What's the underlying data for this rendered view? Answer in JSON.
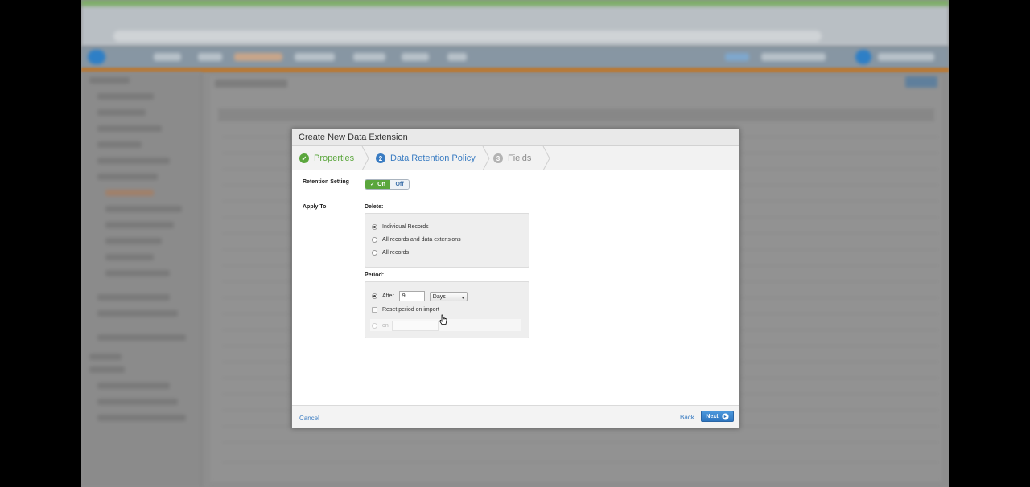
{
  "modal": {
    "title": "Create New Data Extension"
  },
  "steps": [
    {
      "number": "✓",
      "label": "Properties",
      "state": "complete",
      "color": "#5aa63c"
    },
    {
      "number": "2",
      "label": "Data Retention Policy",
      "state": "active",
      "color": "#3a7cc2"
    },
    {
      "number": "3",
      "label": "Fields",
      "state": "inactive",
      "color": "#9a9a9a"
    }
  ],
  "retention": {
    "label": "Retention Setting",
    "on_label": "On",
    "off_label": "Off",
    "value": "On"
  },
  "apply_to": {
    "label": "Apply To",
    "delete_label": "Delete:",
    "options": [
      {
        "label": "Individual Records",
        "selected": true
      },
      {
        "label": "All records and data extensions",
        "selected": false
      },
      {
        "label": "All records",
        "selected": false
      }
    ]
  },
  "period": {
    "label": "Period:",
    "after_label": "After",
    "after_value": "9",
    "unit": "Days",
    "reset_label": "Reset period on import",
    "on_label": "on",
    "on_value": ""
  },
  "footer": {
    "cancel": "Cancel",
    "back": "Back",
    "next": "Next"
  },
  "colors": {
    "accent_blue": "#3a7cc2",
    "success_green": "#5aa63c"
  }
}
